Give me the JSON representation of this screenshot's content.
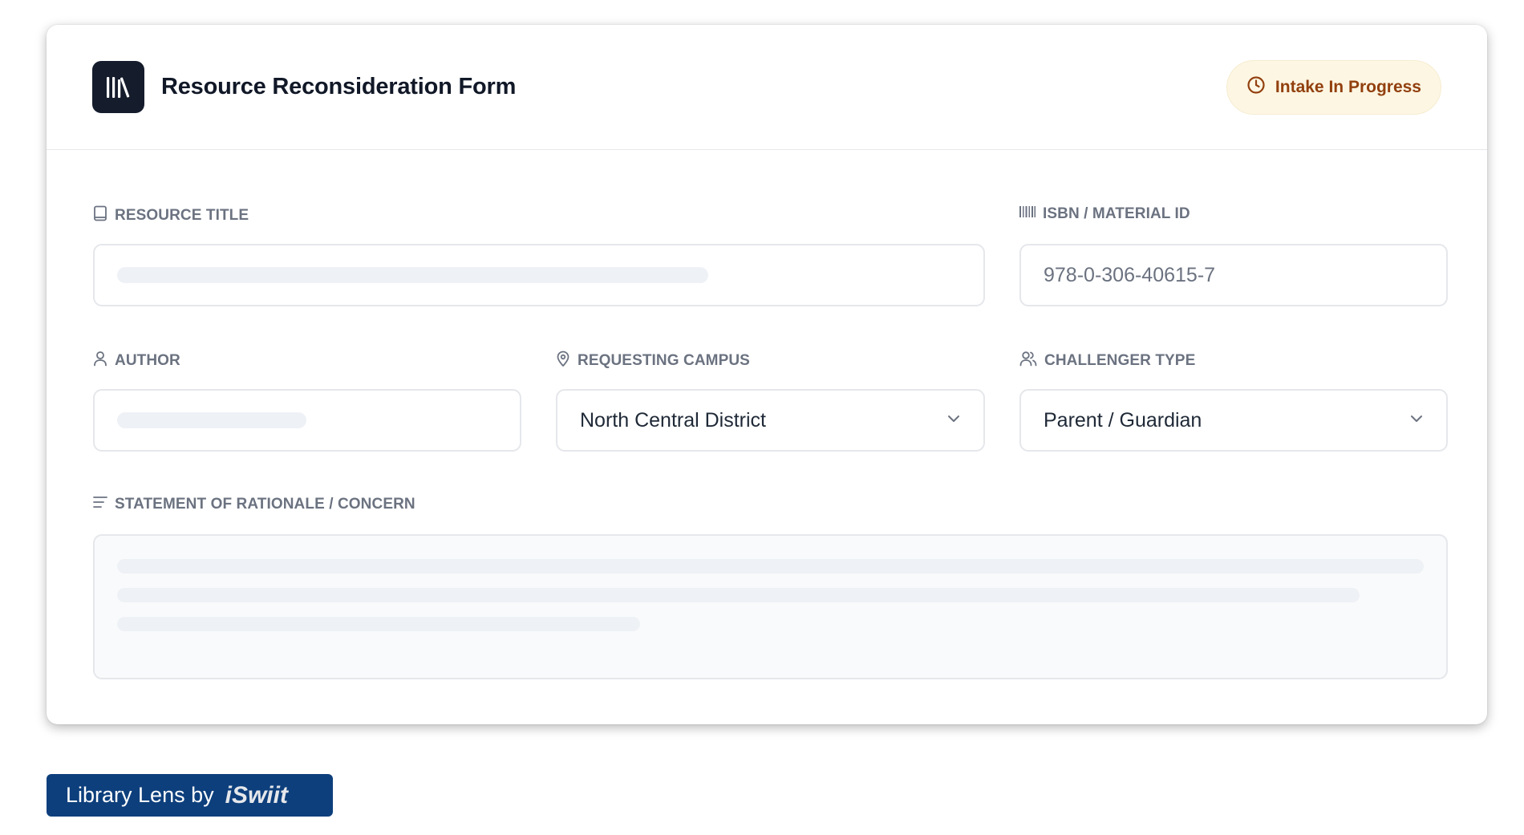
{
  "header": {
    "logo_icon": "library-books-icon",
    "title": "Resource Reconsideration Form",
    "status": {
      "label": "Intake In Progress",
      "icon": "clock-icon"
    }
  },
  "form": {
    "resource_title": {
      "label": "RESOURCE TITLE",
      "icon": "book-icon"
    },
    "isbn": {
      "label": "ISBN / MATERIAL ID",
      "icon": "barcode-icon",
      "placeholder": "978-0-306-40615-7"
    },
    "author": {
      "label": "AUTHOR",
      "icon": "user-icon"
    },
    "campus": {
      "label": "REQUESTING CAMPUS",
      "icon": "map-pin-icon",
      "value": "North Central District"
    },
    "challenger": {
      "label": "CHALLENGER TYPE",
      "icon": "users-icon",
      "value": "Parent / Guardian"
    },
    "rationale": {
      "label": "STATEMENT OF RATIONALE / CONCERN",
      "icon": "text-lines-icon"
    }
  },
  "footer": {
    "brand_text": "Library Lens by",
    "brand_logo": "iSwiit"
  },
  "colors": {
    "accent_dark": "#151c2c",
    "badge_bg": "#fdf6e3",
    "badge_text": "#92400e",
    "banner_bg": "#0d3f7c"
  }
}
